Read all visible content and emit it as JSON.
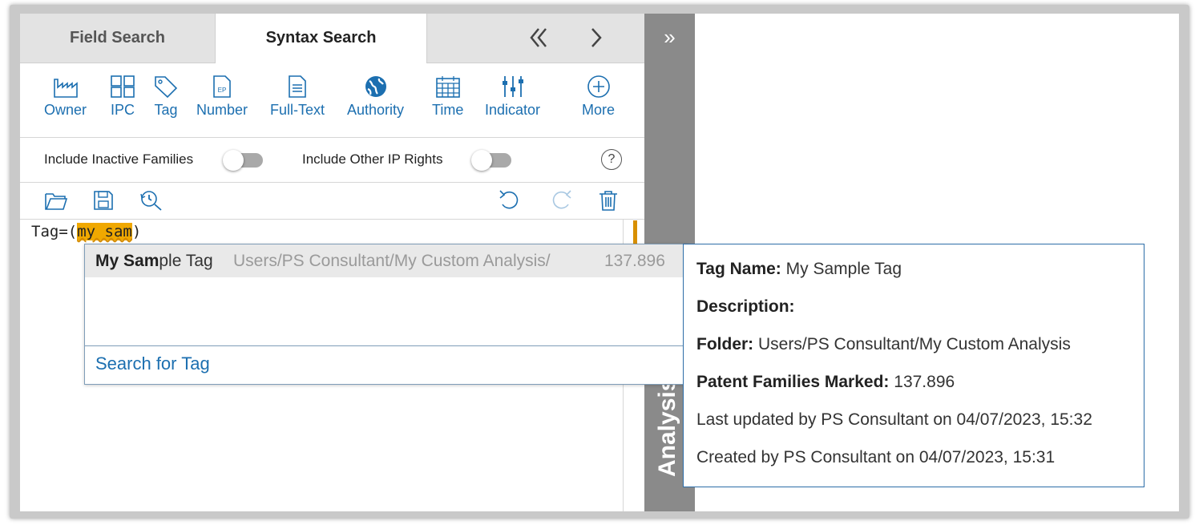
{
  "tabs": {
    "field_search": "Field Search",
    "syntax_search": "Syntax Search",
    "prev_icon": "double-chevron-left-icon",
    "next_icon": "chevron-right-icon"
  },
  "tools": [
    {
      "label": "Owner",
      "icon": "factory-icon"
    },
    {
      "label": "IPC",
      "icon": "grid-icon"
    },
    {
      "label": "Tag",
      "icon": "tag-icon"
    },
    {
      "label": "Number",
      "icon": "ep-document-icon"
    },
    {
      "label": "Full-Text",
      "icon": "text-document-icon"
    },
    {
      "label": "Authority",
      "icon": "globe-icon"
    },
    {
      "label": "Time",
      "icon": "calendar-icon"
    },
    {
      "label": "Indicator",
      "icon": "sliders-icon"
    },
    {
      "label": "More",
      "icon": "plus-circle-icon"
    }
  ],
  "toggles": {
    "inactive_families": {
      "label": "Include Inactive Families",
      "on": false
    },
    "other_ip_rights": {
      "label": "Include Other IP Rights",
      "on": false
    },
    "help": "?"
  },
  "actions": [
    "open-folder-icon",
    "save-icon",
    "history-search-icon",
    "undo-icon",
    "redo-icon",
    "trash-icon"
  ],
  "editor": {
    "prefix": "Tag=(",
    "highlight": "my sam",
    "suffix": ")"
  },
  "right_strip": {
    "expand": "»",
    "title": "Analysis"
  },
  "dropdown": {
    "item": {
      "name_bold": "My Sam",
      "name_rest": "ple Tag",
      "path": "Users/PS Consultant/My Custom Analysis/",
      "count": "137.896"
    },
    "footer": "Search for Tag"
  },
  "details": {
    "tag_name_label": "Tag Name:",
    "tag_name": "My Sample Tag",
    "description_label": "Description:",
    "description": "",
    "folder_label": "Folder:",
    "folder": "Users/PS Consultant/My Custom Analysis",
    "marked_label": "Patent Families Marked:",
    "marked": "137.896",
    "last_updated": "Last updated by PS Consultant on 04/07/2023, 15:32",
    "created": "Created by PS Consultant on 04/07/2023, 15:31"
  },
  "colors": {
    "accent": "#1c6fb0",
    "highlight": "#f0a800",
    "strip": "#8a8a8a",
    "details_border": "#2d6da8"
  }
}
